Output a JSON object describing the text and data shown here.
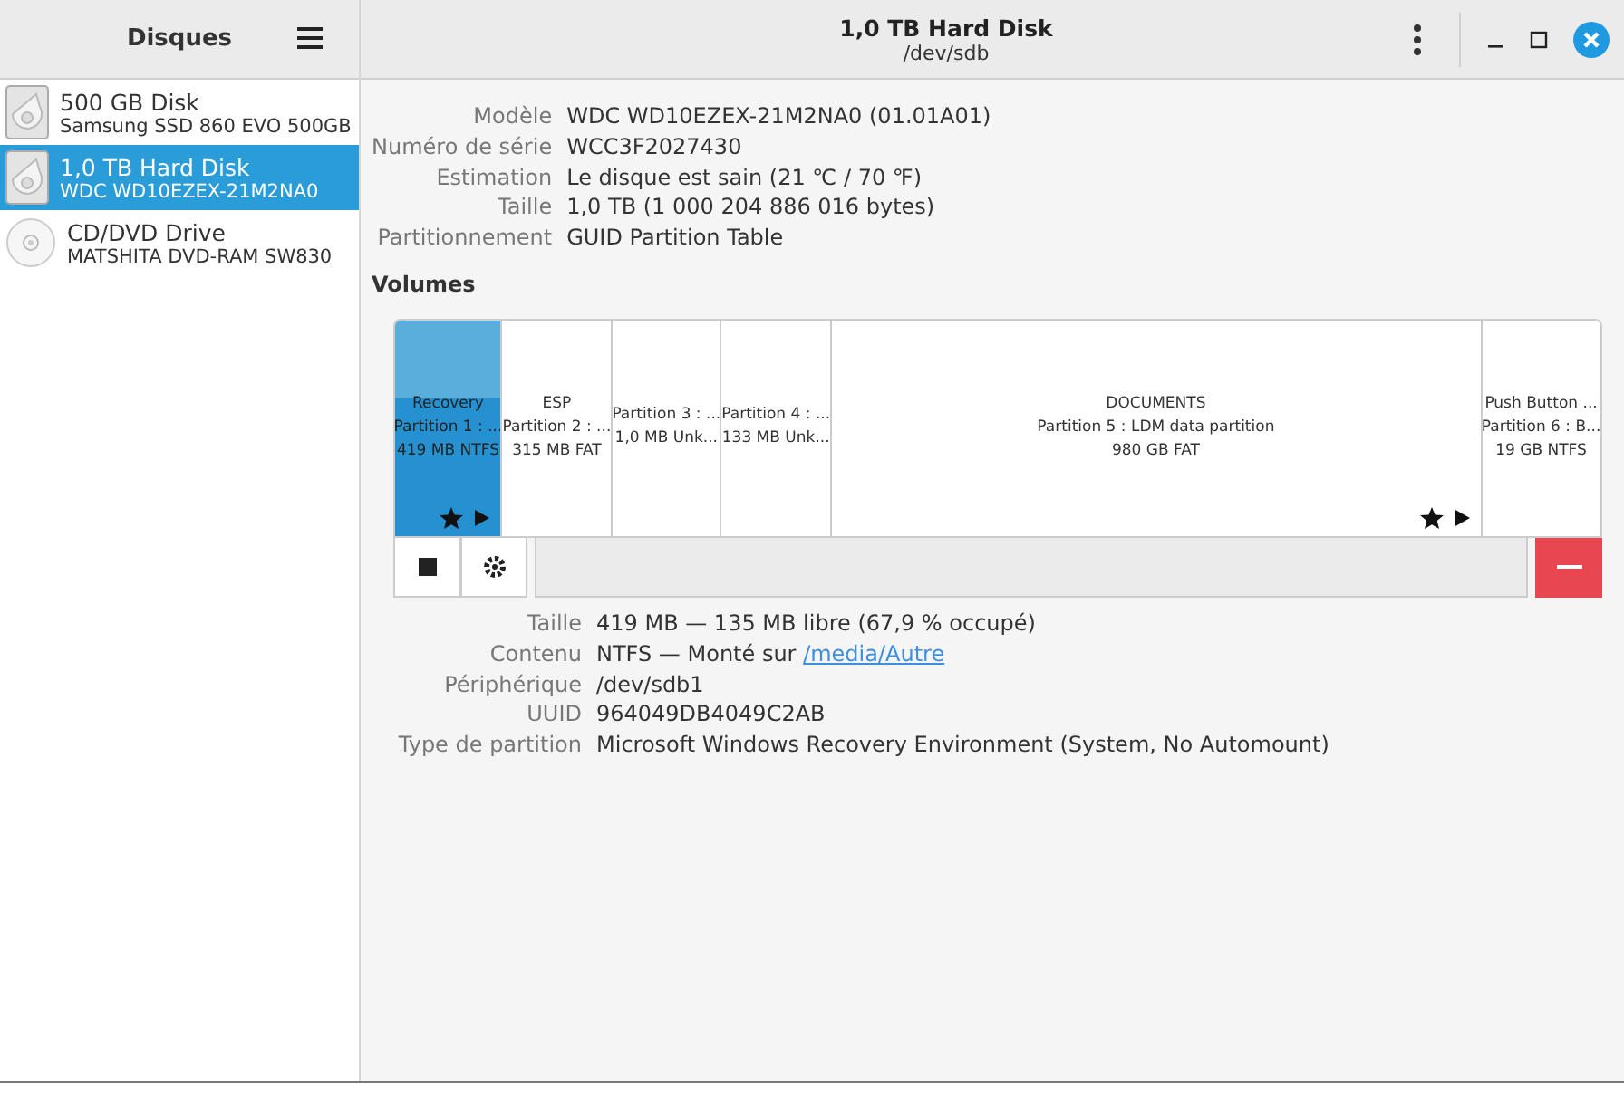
{
  "sidebar": {
    "title": "Disques",
    "items": [
      {
        "name": "500 GB Disk",
        "model": "Samsung SSD 860 EVO 500GB",
        "kind": "hdd",
        "selected": false
      },
      {
        "name": "1,0 TB Hard Disk",
        "model": "WDC WD10EZEX-21M2NA0",
        "kind": "hdd",
        "selected": true
      },
      {
        "name": "CD/DVD Drive",
        "model": "MATSHITA DVD-RAM SW830",
        "kind": "optical",
        "selected": false
      }
    ]
  },
  "window": {
    "title": "1,0 TB Hard Disk",
    "subtitle": "/dev/sdb"
  },
  "disk_info": [
    {
      "label": "Modèle",
      "value": "WDC WD10EZEX-21M2NA0 (01.01A01)"
    },
    {
      "label": "Numéro de série",
      "value": "WCC3F2027430"
    },
    {
      "label": "Estimation",
      "value": "Le disque est sain (21 ℃ / 70 ℉)"
    },
    {
      "label": "Taille",
      "value": "1,0 TB (1 000 204 886 016 bytes)"
    },
    {
      "label": "Partitionnement",
      "value": "GUID Partition Table"
    }
  ],
  "volumes_heading": "Volumes",
  "partitions": [
    {
      "lines": [
        "Recovery",
        "Partition 1 : ...",
        "419 MB NTFS"
      ],
      "selected": true,
      "mounted": true
    },
    {
      "lines": [
        "ESP",
        "Partition 2 : ...",
        "315 MB FAT"
      ],
      "selected": false,
      "mounted": false
    },
    {
      "lines": [
        "Partition 3 : ...",
        "1,0 MB Unk..."
      ],
      "selected": false,
      "mounted": false
    },
    {
      "lines": [
        "Partition 4 : ...",
        "133 MB Unk..."
      ],
      "selected": false,
      "mounted": false
    },
    {
      "lines": [
        "DOCUMENTS",
        "Partition 5 : LDM data partition",
        "980 GB FAT"
      ],
      "selected": false,
      "mounted": true
    },
    {
      "lines": [
        "Push Button ...",
        "Partition 6 : B...",
        "19 GB NTFS"
      ],
      "selected": false,
      "mounted": false
    }
  ],
  "volume_info": [
    {
      "label": "Taille",
      "value": "419 MB — 135 MB libre (67,9 % occupé)"
    },
    {
      "label": "Contenu",
      "value": "NTFS — Monté sur ",
      "link": "/media/Autre"
    },
    {
      "label": "Périphérique",
      "value": "/dev/sdb1"
    },
    {
      "label": "UUID",
      "value": "964049DB4049C2AB"
    },
    {
      "label": "Type de partition",
      "value": "Microsoft Windows Recovery Environment (System, No Automount)"
    }
  ]
}
